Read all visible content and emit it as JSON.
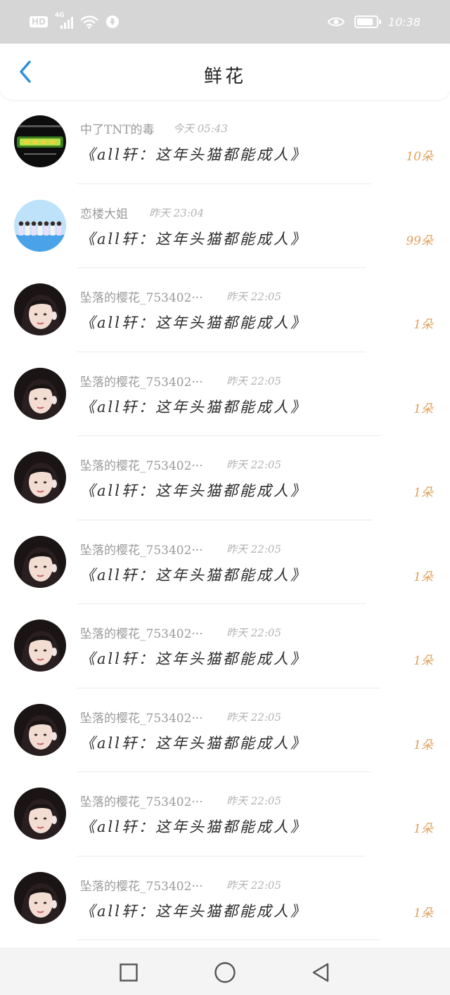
{
  "status_bar": {
    "hd_label": "HD",
    "network_label": "4G",
    "time": "10:38",
    "icons": [
      "signal-icon",
      "wifi-icon",
      "notification-icon",
      "eye-icon",
      "battery-icon"
    ]
  },
  "header": {
    "title": "鲜花",
    "back_icon": "chevron-left-icon",
    "accent_color": "#2a8fe0"
  },
  "list": {
    "count_color": "#e0a15c",
    "items": [
      {
        "name": "中了TNT的毒",
        "time": "今天 05:43",
        "gift": "《all轩：这年头猫都能成人》",
        "count": "10朵",
        "avatar": "poster-avatar"
      },
      {
        "name": "恋楼大姐",
        "time": "昨天 23:04",
        "gift": "《all轩：这年头猫都能成人》",
        "count": "99朵",
        "avatar": "group-photo-avatar"
      },
      {
        "name": "坠落的樱花_753402···",
        "time": "昨天 22:05",
        "gift": "《all轩：这年头猫都能成人》",
        "count": "1朵",
        "avatar": "girl-avatar"
      },
      {
        "name": "坠落的樱花_753402···",
        "time": "昨天 22:05",
        "gift": "《all轩：这年头猫都能成人》",
        "count": "1朵",
        "avatar": "girl-avatar"
      },
      {
        "name": "坠落的樱花_753402···",
        "time": "昨天 22:05",
        "gift": "《all轩：这年头猫都能成人》",
        "count": "1朵",
        "avatar": "girl-avatar"
      },
      {
        "name": "坠落的樱花_753402···",
        "time": "昨天 22:05",
        "gift": "《all轩：这年头猫都能成人》",
        "count": "1朵",
        "avatar": "girl-avatar"
      },
      {
        "name": "坠落的樱花_753402···",
        "time": "昨天 22:05",
        "gift": "《all轩：这年头猫都能成人》",
        "count": "1朵",
        "avatar": "girl-avatar"
      },
      {
        "name": "坠落的樱花_753402···",
        "time": "昨天 22:05",
        "gift": "《all轩：这年头猫都能成人》",
        "count": "1朵",
        "avatar": "girl-avatar"
      },
      {
        "name": "坠落的樱花_753402···",
        "time": "昨天 22:05",
        "gift": "《all轩：这年头猫都能成人》",
        "count": "1朵",
        "avatar": "girl-avatar"
      },
      {
        "name": "坠落的樱花_753402···",
        "time": "昨天 22:05",
        "gift": "《all轩：这年头猫都能成人》",
        "count": "1朵",
        "avatar": "girl-avatar"
      }
    ]
  },
  "nav_bar": {
    "icons": [
      "recent-apps-icon",
      "home-icon",
      "back-triangle-icon"
    ]
  }
}
